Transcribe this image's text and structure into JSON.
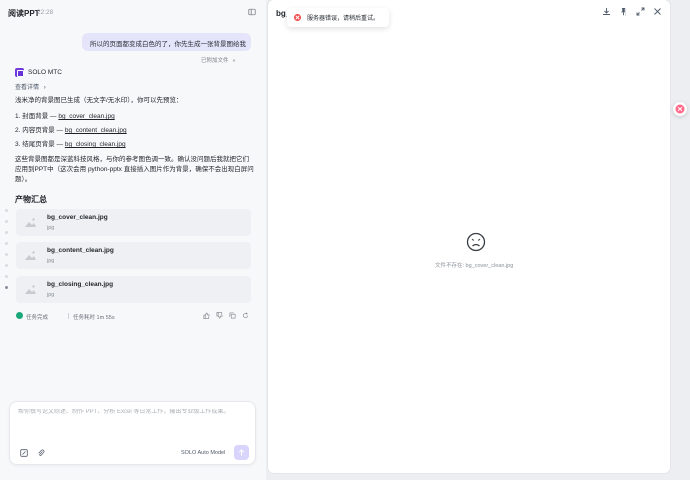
{
  "app": {
    "title": "阅读PPT",
    "time": "22:28"
  },
  "chat": {
    "user_message": "所以的页面都变成白色的了，你先生成一张背景图给我",
    "attachment_note": "已附加文件",
    "attachment_chevron": "»",
    "agent_name": "SOLO MTC",
    "view_details": "查看详情",
    "view_details_chevron": "›",
    "intro": "浅米净的背景图已生成（无文字/无水印），你可以先预览：",
    "list": [
      {
        "num": "1.",
        "label": "封面背景 — ",
        "file": "bg_cover_clean.jpg"
      },
      {
        "num": "2.",
        "label": "内容页背景 — ",
        "file": "bg_content_clean.jpg"
      },
      {
        "num": "3.",
        "label": "结尾页背景 — ",
        "file": "bg_closing_clean.jpg"
      }
    ],
    "outro": "这些背景图都是深蓝科技风格，与你的参考图色调一致。确认没问题后我就把它们应用到PPT中（这次会用 python-pptx 直接插入图片作为背景，确保不会出现白屏问题）。",
    "section_title": "产物汇总",
    "files": [
      {
        "name": "bg_cover_clean.jpg",
        "ext": "jpg"
      },
      {
        "name": "bg_content_clean.jpg",
        "ext": "jpg"
      },
      {
        "name": "bg_closing_clean.jpg",
        "ext": "jpg"
      }
    ],
    "status": {
      "done": "任务完成",
      "elapsed": "任务耗时 1m 55s"
    }
  },
  "composer": {
    "placeholder": "帮你撰写论文综述、制作 PPT、分析 Excel 等日常工作，输出专业级工作成果。",
    "value": "",
    "model": "SOLO Auto Model"
  },
  "preview": {
    "title": "bg_",
    "toast": "服务器错误，请稍后重试。",
    "empty_message": "文件不存在: bg_cover_clean.jpg"
  },
  "colors": {
    "accent": "#7b3fe4",
    "user_bubble": "#e4e5fb",
    "success": "#1aa87a",
    "error": "#f04747"
  }
}
